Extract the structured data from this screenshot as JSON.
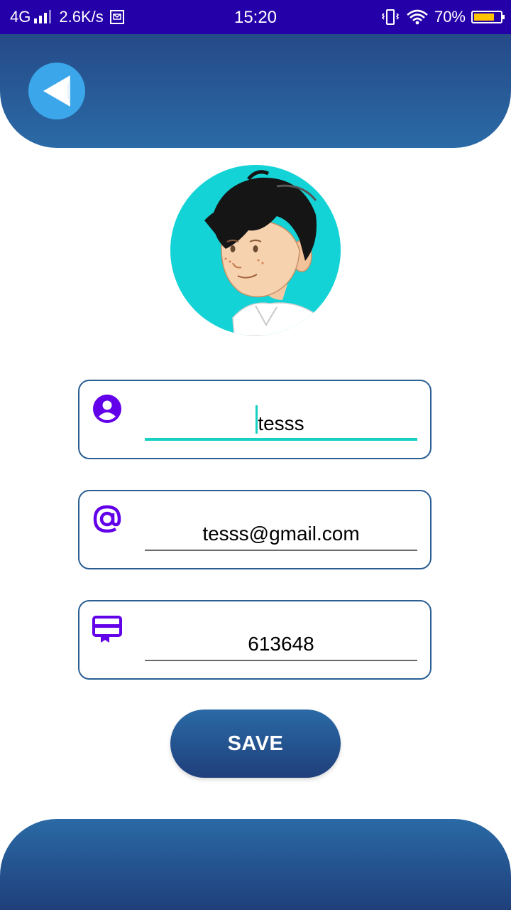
{
  "status_bar": {
    "network": "4G",
    "speed": "2.6K/s",
    "time": "15:20",
    "battery": "70%",
    "icons": [
      "signal-icon",
      "mail-icon",
      "vibrate-icon",
      "wifi-icon",
      "battery-icon"
    ],
    "battery_level": 0.7,
    "battery_color": "#ffc400"
  },
  "header": {
    "back_icon": "back-arrow-icon",
    "color_top": "#254a88",
    "color_bottom": "#2a6aa6"
  },
  "avatar": {
    "background_color": "#13d3d7"
  },
  "form": {
    "name_field": {
      "icon": "account-circle-icon",
      "value": "tesss"
    },
    "email_field": {
      "icon": "at-sign-icon",
      "value": "tesss@gmail.com"
    },
    "id_field": {
      "icon": "id-card-icon",
      "value": "613648"
    },
    "icon_color": "#6200ea",
    "accent_color": "#18cfc3"
  },
  "save_button": {
    "label": "SAVE"
  }
}
